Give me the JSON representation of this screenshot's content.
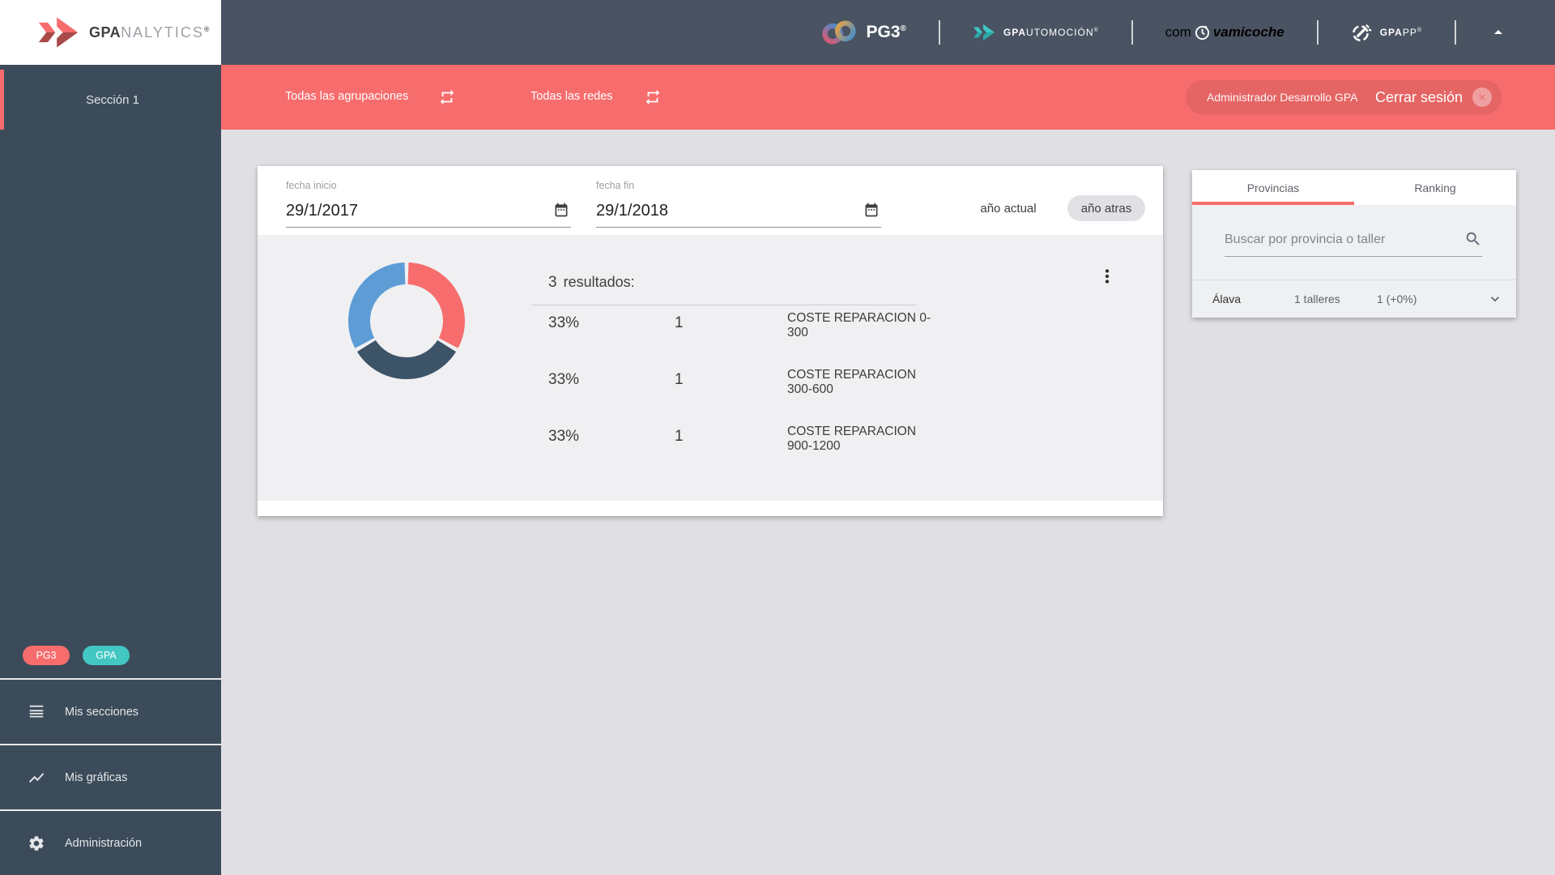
{
  "header": {
    "brand": {
      "gpa": "GPA",
      "rest": "NALYTICS",
      "reg": "®"
    },
    "logos": {
      "pg3": "PG3",
      "pg3_reg": "®",
      "auto_bold": "GPA",
      "auto_rest": "UTOMOCIÓN",
      "auto_reg": "®",
      "com": "com",
      "coche": "vamicoche",
      "app_bold": "GPA",
      "app_rest": "PP",
      "app_reg": "®"
    }
  },
  "sidebar": {
    "section": "Sección 1",
    "badges": [
      {
        "label": "PG3",
        "color": "#f76c6c"
      },
      {
        "label": "GPA",
        "color": "#42c7c3"
      }
    ],
    "menu": [
      {
        "label": "Mis secciones"
      },
      {
        "label": "Mis gráficas"
      },
      {
        "label": "Administración"
      }
    ]
  },
  "toolbar": {
    "agrupaciones": "Todas las agrupaciones",
    "redes": "Todas las redes",
    "admin_user": "Administrador Desarrollo GPA",
    "logout": "Cerrar sesión"
  },
  "filters": {
    "fecha_inicio_label": "fecha inicio",
    "fecha_inicio_value": "29/1/2017",
    "fecha_fin_label": "fecha fin",
    "fecha_fin_value": "29/1/2018",
    "ano_actual": "año actual",
    "ano_atras": "año atras"
  },
  "results": {
    "count": "3",
    "count_label": "resultados:",
    "rows": [
      {
        "pct": "33%",
        "value": "1",
        "label": "COSTE REPARACION 0-300"
      },
      {
        "pct": "33%",
        "value": "1",
        "label": "COSTE REPARACION 300-600"
      },
      {
        "pct": "33%",
        "value": "1",
        "label": "COSTE REPARACION 900-1200"
      }
    ]
  },
  "chart_data": {
    "type": "pie",
    "title": "",
    "categories": [
      "COSTE REPARACION 0-300",
      "COSTE REPARACION 300-600",
      "COSTE REPARACION 900-1200"
    ],
    "values": [
      33.33,
      33.33,
      33.33
    ],
    "counts": [
      1,
      1,
      1
    ],
    "colors": [
      "#f76c6c",
      "#3d5368",
      "#5e9cd6"
    ],
    "legend_position": "right-list",
    "donut": true
  },
  "panel": {
    "tabs": [
      {
        "label": "Provincias",
        "active": true
      },
      {
        "label": "Ranking",
        "active": false
      }
    ],
    "search_placeholder": "Buscar por provincia o taller",
    "rows": [
      {
        "name": "Álava",
        "talleres": "1 talleres",
        "value": "1 (+0%)"
      }
    ]
  },
  "accent_color": "#f76c6c",
  "sidebar_color": "#3c4b59",
  "header_color": "#4a5362"
}
